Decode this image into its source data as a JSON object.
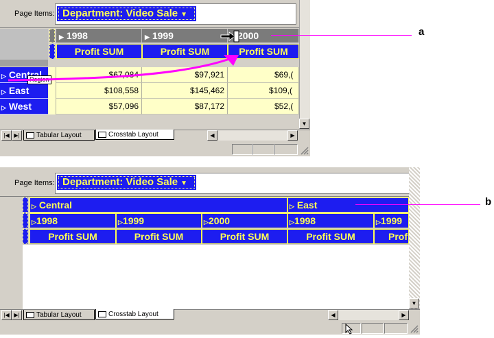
{
  "window_a": {
    "page_items_label": "Page Items:",
    "page_item_dropdown": "Department: Video Sale",
    "years": [
      "1998",
      "1999",
      "2000"
    ],
    "measure": "Profit SUM",
    "rows": [
      {
        "region": "Central",
        "values": [
          "$67,084",
          "$97,921",
          "$69,("
        ]
      },
      {
        "region": "East",
        "values": [
          "$108,558",
          "$145,462",
          "$109,("
        ]
      },
      {
        "region": "West",
        "values": [
          "$57,096",
          "$87,172",
          "$52,("
        ]
      }
    ],
    "drag_tooltip": "Region",
    "tabs": [
      "Tabular Layout",
      "Crosstab Layout"
    ],
    "callout": "a"
  },
  "window_b": {
    "page_items_label": "Page Items:",
    "page_item_dropdown": "Department: Video Sale",
    "regions": [
      "Central",
      "East"
    ],
    "years": [
      "1998",
      "1999",
      "2000",
      "1998",
      "1999"
    ],
    "measures": [
      "Profit SUM",
      "Profit SUM",
      "Profit SUM",
      "Profit SUM",
      "Prof"
    ],
    "tabs": [
      "Tabular Layout",
      "Crosstab Layout"
    ],
    "callout": "b"
  },
  "colors": {
    "header_blue": "#1d1df0",
    "header_text": "#ffff55",
    "data_bg": "#ffffc8",
    "annotation_arrow": "#ff00ff"
  },
  "icons": [
    "dropdown-triangle-icon",
    "expand-triangle-icon",
    "drag-cursor-icon",
    "scroll-arrow-icon",
    "resize-grip-icon",
    "mouse-pointer-icon"
  ]
}
